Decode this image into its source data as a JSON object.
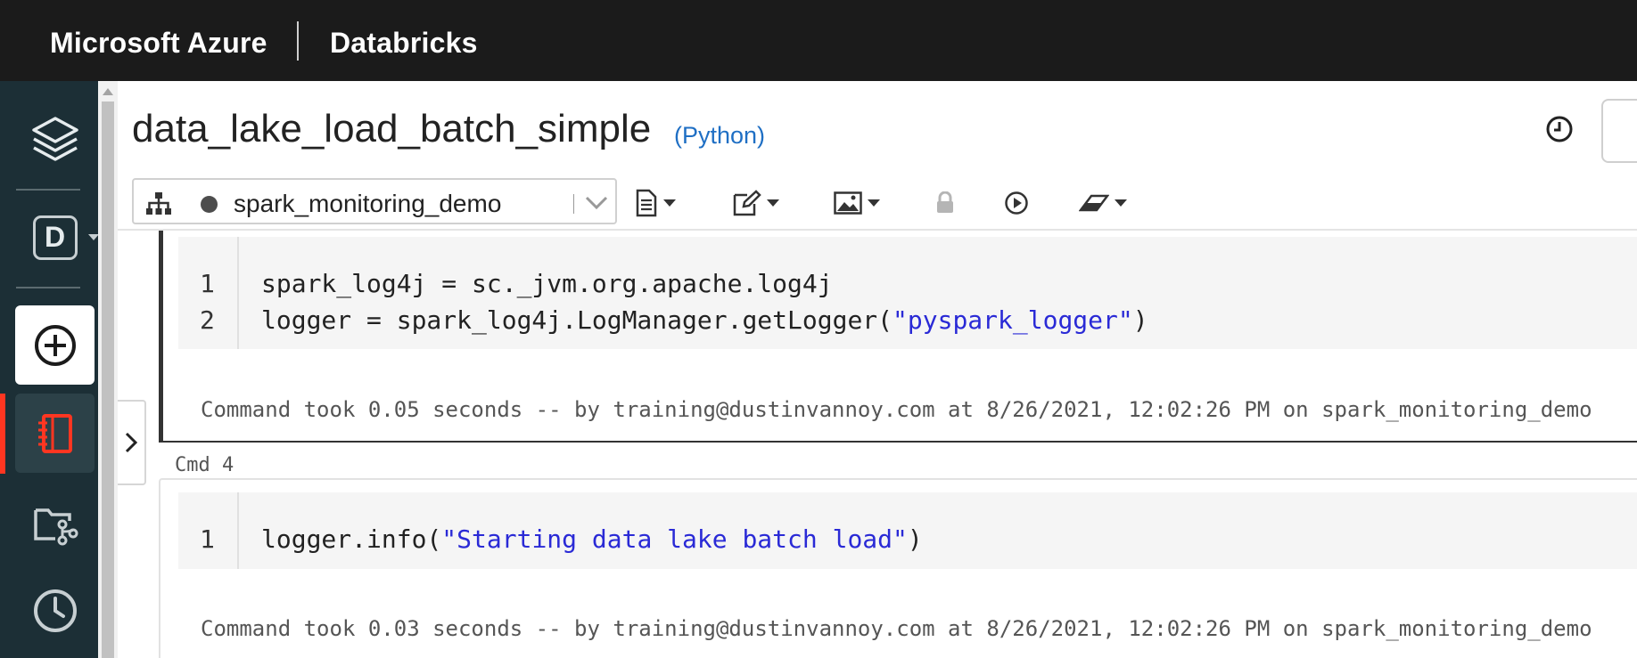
{
  "topbar": {
    "brand_azure": "Microsoft Azure",
    "brand_databricks": "Databricks"
  },
  "sidebar": {
    "workspace_letter": "D",
    "items": [
      {
        "name": "databricks-logo",
        "icon": "layers-icon"
      },
      {
        "name": "workspace-switcher",
        "icon": "d-badge-icon"
      },
      {
        "name": "create",
        "icon": "plus-circle-icon"
      },
      {
        "name": "workspace",
        "icon": "notebook-icon",
        "active": true
      },
      {
        "name": "repos",
        "icon": "repo-branch-icon"
      },
      {
        "name": "recents",
        "icon": "clock-icon"
      }
    ],
    "accent_color": "#ff3621"
  },
  "notebook": {
    "title": "data_lake_load_batch_simple",
    "language": "(Python)"
  },
  "toolbar": {
    "cluster_name": "spark_monitoring_demo",
    "buttons": [
      "file-menu",
      "edit-menu",
      "view-menu",
      "permissions-lock",
      "run-all",
      "clear-menu"
    ]
  },
  "cells": [
    {
      "lines": [
        {
          "num": "1",
          "code": "spark_log4j = sc._jvm.org.apache.log4j",
          "string": ""
        },
        {
          "num": "2",
          "code": "logger = spark_log4j.LogManager.getLogger(",
          "string": "\"pyspark_logger\"",
          "after": ")"
        }
      ],
      "result": "Command took 0.05 seconds -- by training@dustinvannoy.com at 8/26/2021, 12:02:26 PM on spark_monitoring_demo"
    },
    {
      "label": "Cmd 4",
      "lines": [
        {
          "num": "1",
          "code": "logger.info(",
          "string": "\"Starting data lake batch load\"",
          "after": ")"
        }
      ],
      "result": "Command took 0.03 seconds -- by training@dustinvannoy.com at 8/26/2021, 12:02:26 PM on spark_monitoring_demo"
    }
  ],
  "colors": {
    "topbar": "#1b1b1b",
    "sidebar": "#1c2f36",
    "language_link": "#1f6fc4",
    "code_string": "#2a2ad6"
  }
}
